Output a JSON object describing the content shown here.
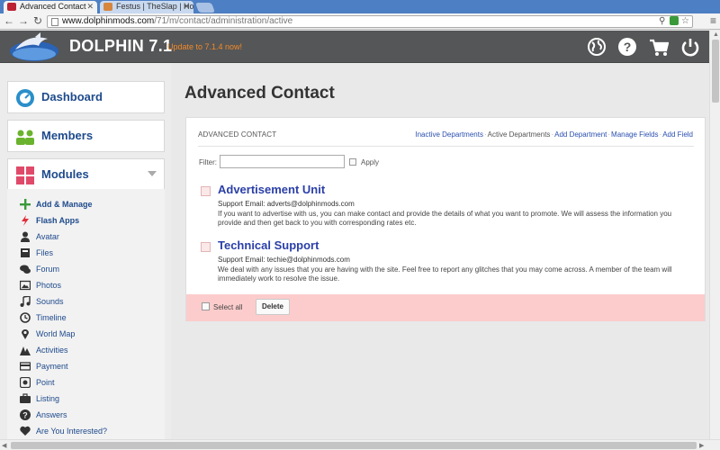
{
  "browser": {
    "tabs": [
      {
        "title": "Advanced Contact",
        "active": true
      },
      {
        "title": "Festus | TheSlap | Ho",
        "active": false
      }
    ],
    "url_host": "www.dolphinmods.com",
    "url_path": "/71/m/contact/administration/active"
  },
  "header": {
    "brand": "DOLPHIN 7.1",
    "update_notice": "Update to 7.1.4 now!",
    "icons": [
      "globe-icon",
      "help-icon",
      "cart-icon",
      "power-icon"
    ],
    "accent_color": "#f08a2a"
  },
  "sidebar": {
    "dashboard": "Dashboard",
    "members": "Members",
    "modules": "Modules",
    "items": [
      {
        "label": "Add & Manage",
        "icon": "plus-icon",
        "bold": true
      },
      {
        "label": "Flash Apps",
        "icon": "flash-icon",
        "bold": true
      },
      {
        "label": "Avatar",
        "icon": "user-icon",
        "bold": false
      },
      {
        "label": "Files",
        "icon": "file-icon",
        "bold": false
      },
      {
        "label": "Forum",
        "icon": "comments-icon",
        "bold": false
      },
      {
        "label": "Photos",
        "icon": "photo-icon",
        "bold": false
      },
      {
        "label": "Sounds",
        "icon": "music-icon",
        "bold": false
      },
      {
        "label": "Timeline",
        "icon": "clock-icon",
        "bold": false
      },
      {
        "label": "World Map",
        "icon": "map-marker-icon",
        "bold": false
      },
      {
        "label": "Activities",
        "icon": "activity-icon",
        "bold": false
      },
      {
        "label": "Payment",
        "icon": "credit-card-icon",
        "bold": false
      },
      {
        "label": "Point",
        "icon": "point-icon",
        "bold": false
      },
      {
        "label": "Listing",
        "icon": "briefcase-icon",
        "bold": false
      },
      {
        "label": "Answers",
        "icon": "question-icon",
        "bold": false
      },
      {
        "label": "Are You Interested?",
        "icon": "heart-icon",
        "bold": false
      }
    ]
  },
  "main": {
    "title": "Advanced Contact",
    "panel_caption": "ADVANCED CONTACT",
    "menu": [
      {
        "label": "Inactive Departments",
        "active": false
      },
      {
        "label": "Active Departments",
        "active": true
      },
      {
        "label": "Add Department",
        "active": false
      },
      {
        "label": "Manage Fields",
        "active": false
      },
      {
        "label": "Add Field",
        "active": false
      }
    ],
    "filter_label": "Filter:",
    "filter_value": "",
    "apply_label": "Apply",
    "departments": [
      {
        "name": "Advertisement Unit",
        "email": "Support Email: adverts@dolphinmods.com",
        "description": "If you want to advertise with us, you can make contact and provide the details of what you want to promote. We will assess the information you provide and then get back to you with corresponding rates etc."
      },
      {
        "name": "Technical Support",
        "email": "Support Email: techie@dolphinmods.com",
        "description": "We deal with any issues that you are having with the site. Feel free to report any glitches that you may come across. A member of the team will immediately work to resolve the issue."
      }
    ],
    "select_all_label": "Select all",
    "delete_label": "Delete",
    "bulk_bar_color": "#fccccc"
  }
}
